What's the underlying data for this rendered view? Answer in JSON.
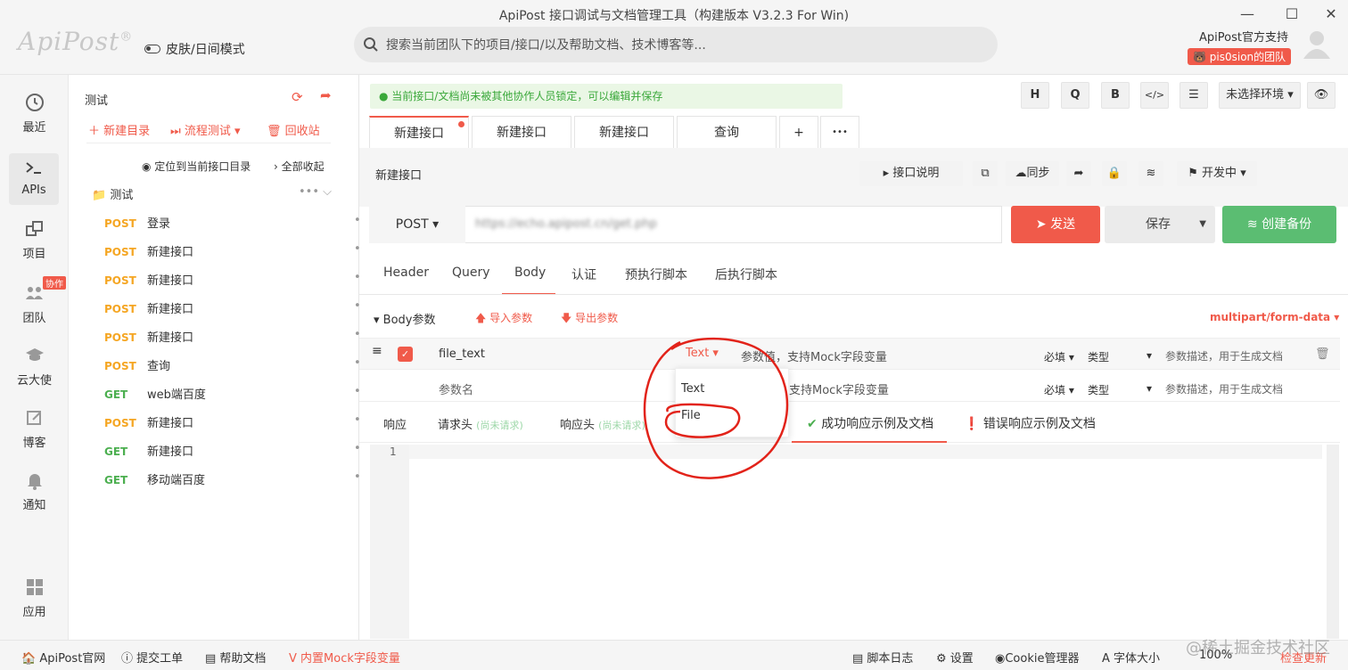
{
  "window": {
    "title": "ApiPost 接口调试与文档管理工具（构建版本 V3.2.3 For Win)"
  },
  "brand": {
    "logo_text": "ApiPost"
  },
  "header": {
    "skin_mode": "皮肤/日间模式",
    "search_placeholder": "搜索当前团队下的项目/接口/以及帮助文档、技术博客等...",
    "support": "ApiPost官方支持",
    "team": "pis0sion的团队"
  },
  "nav": {
    "items": [
      {
        "label": "最近",
        "icon": "clock-icon"
      },
      {
        "label": "APIs",
        "icon": "terminal-icon"
      },
      {
        "label": "项目",
        "icon": "project-icon"
      },
      {
        "label": "团队",
        "icon": "team-icon",
        "badge": "协作"
      },
      {
        "label": "云大使",
        "icon": "graduation-cap-icon"
      },
      {
        "label": "博客",
        "icon": "edit-icon"
      },
      {
        "label": "通知",
        "icon": "bell-icon"
      },
      {
        "label": "应用",
        "icon": "apps-icon"
      }
    ]
  },
  "tree": {
    "title": "测试",
    "new_folder": "新建目录",
    "flow_test": "流程测试",
    "recycle": "回收站",
    "locate": "定位到当前接口目录",
    "collapse": "全部收起",
    "folder": "测试",
    "items": [
      {
        "method": "POST",
        "name": "登录"
      },
      {
        "method": "POST",
        "name": "新建接口"
      },
      {
        "method": "POST",
        "name": "新建接口"
      },
      {
        "method": "POST",
        "name": "新建接口"
      },
      {
        "method": "POST",
        "name": "新建接口"
      },
      {
        "method": "POST",
        "name": "查询"
      },
      {
        "method": "GET",
        "name": "web端百度"
      },
      {
        "method": "POST",
        "name": "新建接口"
      },
      {
        "method": "GET",
        "name": "新建接口"
      },
      {
        "method": "GET",
        "name": "移动端百度"
      }
    ]
  },
  "main": {
    "notice": "当前接口/文档尚未被其他协作人员锁定，可以编辑并保存",
    "toolbar": {
      "h": "H",
      "q": "Q",
      "b": "B",
      "code": "</>",
      "env": "未选择环境"
    },
    "tabs": [
      "新建接口",
      "新建接口",
      "新建接口",
      "查询"
    ],
    "tab_add": "+",
    "tab_more": "•••",
    "api_name": "新建接口",
    "doc_btn": "接口说明",
    "sync_btn": "同步",
    "status_btn": "开发中",
    "method": "POST",
    "url": "https://echo.apipost.cn/get.php",
    "send": "发送",
    "save": "保存",
    "backup": "创建备份",
    "req_tabs": [
      "Header",
      "Query",
      "Body",
      "认证",
      "预执行脚本",
      "后执行脚本"
    ],
    "body_label": "Body参数",
    "import": "导入参数",
    "export": "导出参数",
    "content_type": "multipart/form-data",
    "params": [
      {
        "name": "file_text",
        "type_sel": "Text",
        "value_ph": "参数值，支持Mock字段变量",
        "required": "必填",
        "datatype": "类型",
        "desc": "参数描述，用于生成文档"
      },
      {
        "name": "参数名",
        "type_sel": "",
        "value_ph": "参数值，支持Mock字段变量",
        "required": "必填",
        "datatype": "类型",
        "desc": "参数描述，用于生成文档"
      }
    ],
    "dropdown": [
      "Text",
      "File"
    ],
    "resp_tabs": {
      "resp": "响应",
      "req_head": "请求头",
      "pending1": "(尚未请求)",
      "resp_head": "响应头",
      "pending2": "(尚未请求)",
      "success": "成功响应示例及文档",
      "error": "错误响应示例及文档"
    },
    "line_no": "1"
  },
  "footer": {
    "items": [
      "ApiPost官网",
      "提交工单",
      "帮助文档",
      "内置Mock字段变量"
    ],
    "right": [
      "脚本日志",
      "设置",
      "Cookie管理器",
      "字体大小",
      "100%",
      "检查更新"
    ],
    "watermark": "@稀土掘金技术社区"
  },
  "colors": {
    "accent": "#f05a4a",
    "green": "#4caf50",
    "post": "#f5a623"
  }
}
